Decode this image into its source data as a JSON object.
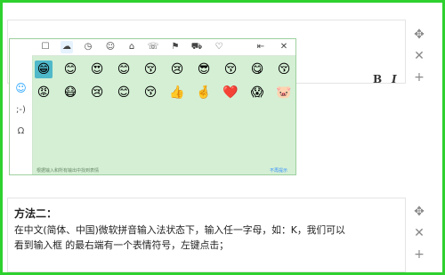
{
  "right_tools": {
    "move_icon": "✥",
    "close_icon": "✕",
    "add_icon": "+"
  },
  "format": {
    "bold_label": "B",
    "italic_label": "I"
  },
  "emoji_panel": {
    "sidebar": {
      "items": [
        {
          "label": "☺"
        },
        {
          "label": ";-)"
        },
        {
          "label": "Ω"
        }
      ]
    },
    "tabs": [
      {
        "label": "☐"
      },
      {
        "label": "☁"
      },
      {
        "label": "◷"
      },
      {
        "label": "☺"
      },
      {
        "label": "⌂"
      },
      {
        "label": "☏"
      },
      {
        "label": "⚑"
      },
      {
        "label": "⛟"
      },
      {
        "label": "♡"
      },
      {
        "label": "⇤"
      },
      {
        "label": "✕"
      }
    ],
    "emojis": [
      [
        "😁",
        "😊",
        "😍",
        "😊",
        "😚",
        "😢",
        "😎",
        "😚",
        "😋",
        "😚"
      ],
      [
        "😡",
        "😷",
        "😢",
        "😊",
        "😚",
        "👍",
        "🤞",
        "❤️",
        "😱",
        "🐷"
      ]
    ],
    "hint_text": "根据输入和所有输出中找到表情",
    "unused_label": "不再提示"
  },
  "article": {
    "section_title": "方法二：",
    "line1": "在中文(简体、中国)微软拼音输入法状态下，输入任一字母，如：K，我们可以",
    "line2": "看到输入框 的最右端有一个表情符号，左键点击；"
  }
}
